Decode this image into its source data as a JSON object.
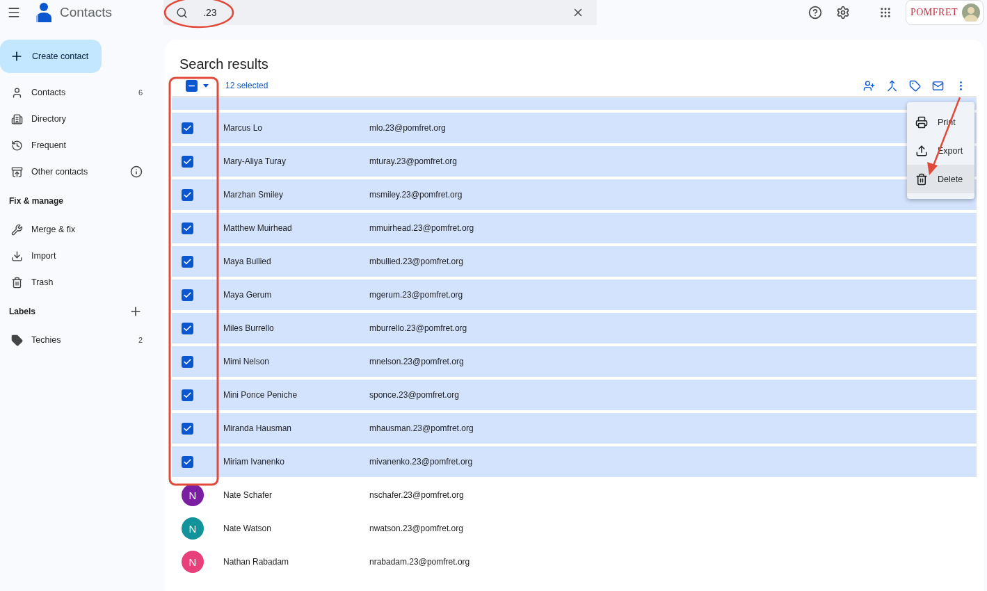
{
  "app": {
    "title": "Contacts"
  },
  "search": {
    "value": ".23"
  },
  "account": {
    "org": "POMFRET"
  },
  "create_button": "Create contact",
  "sidebar": {
    "sections": [
      {
        "items": [
          {
            "label": "Contacts",
            "count": "6",
            "info": false
          },
          {
            "label": "Directory",
            "info": false
          },
          {
            "label": "Frequent",
            "info": false
          },
          {
            "label": "Other contacts",
            "info": true
          }
        ]
      },
      {
        "title": "Fix & manage",
        "items": [
          {
            "label": "Merge & fix",
            "info": false
          },
          {
            "label": "Import",
            "info": false
          },
          {
            "label": "Trash",
            "info": false
          }
        ]
      },
      {
        "title": "Labels",
        "add_button": true,
        "items": [
          {
            "label": "Techies",
            "count": "2",
            "info": false
          }
        ]
      }
    ]
  },
  "results": {
    "title": "Search results",
    "select_all": {
      "indeterminate": true
    },
    "selection_label": "12 selected"
  },
  "contacts": [
    {
      "name": "Marcus Lo",
      "email": "mlo.23@pomfret.org",
      "selected": true
    },
    {
      "name": "Mary-Aliya Turay",
      "email": "mturay.23@pomfret.org",
      "selected": true
    },
    {
      "name": "Marzhan Smiley",
      "email": "msmiley.23@pomfret.org",
      "selected": true
    },
    {
      "name": "Matthew Muirhead",
      "email": "mmuirhead.23@pomfret.org",
      "selected": true
    },
    {
      "name": "Maya Bullied",
      "email": "mbullied.23@pomfret.org",
      "selected": true
    },
    {
      "name": "Maya Gerum",
      "email": "mgerum.23@pomfret.org",
      "selected": true
    },
    {
      "name": "Miles Burrello",
      "email": "mburrello.23@pomfret.org",
      "selected": true
    },
    {
      "name": "Mimi Nelson",
      "email": "mnelson.23@pomfret.org",
      "selected": true
    },
    {
      "name": "Mini Ponce Peniche",
      "email": "sponce.23@pomfret.org",
      "selected": true
    },
    {
      "name": "Miranda Hausman",
      "email": "mhausman.23@pomfret.org",
      "selected": true
    },
    {
      "name": "Miriam Ivanenko",
      "email": "mivanenko.23@pomfret.org",
      "selected": true
    },
    {
      "name": "Nate Schafer",
      "email": "nschafer.23@pomfret.org",
      "selected": false,
      "initial": "N",
      "color": "#7b1fa2"
    },
    {
      "name": "Nate Watson",
      "email": "nwatson.23@pomfret.org",
      "selected": false,
      "initial": "N",
      "color": "#12939a"
    },
    {
      "name": "Nathan Rabadam",
      "email": "nrabadam.23@pomfret.org",
      "selected": false,
      "initial": "N",
      "color": "#e8407a"
    }
  ],
  "menu": {
    "items": [
      {
        "label": "Print",
        "selected": false
      },
      {
        "label": "Export",
        "selected": false
      },
      {
        "label": "Delete",
        "selected": true
      }
    ]
  }
}
